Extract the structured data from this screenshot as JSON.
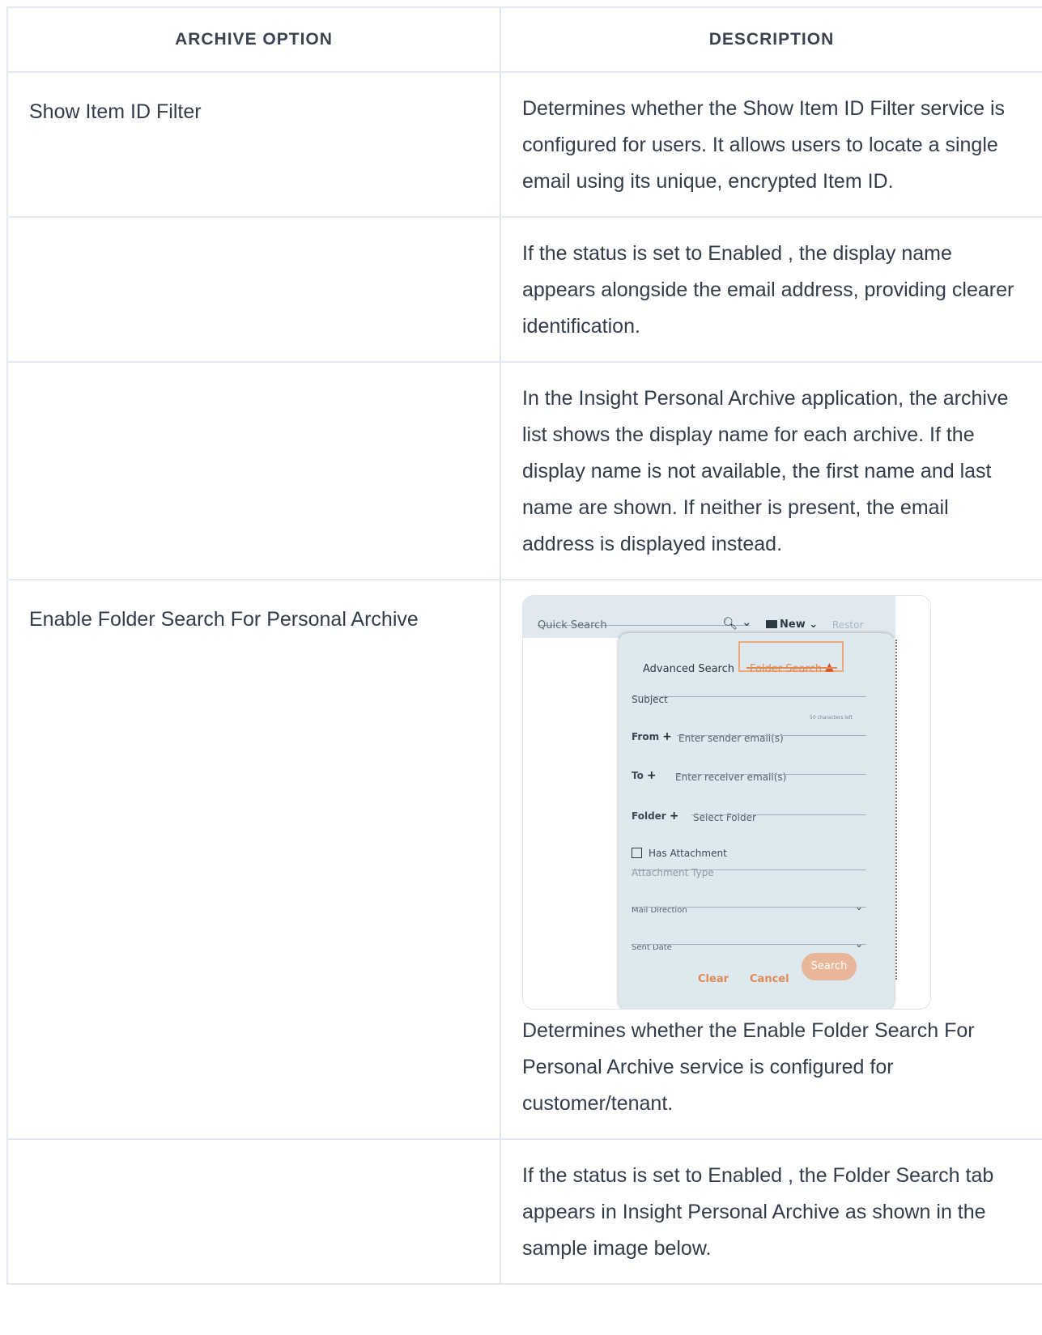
{
  "table": {
    "headers": [
      "ARCHIVE OPTION",
      "DESCRIPTION"
    ],
    "rows": [
      {
        "option": "Show Item ID Filter",
        "description": "Determines whether the Show Item ID Filter service is configured for users. It allows users to locate a single email using its unique, encrypted Item ID."
      },
      {
        "option": "",
        "description": "If the status is set to Enabled , the display name appears alongside the email address, providing clearer identification."
      },
      {
        "option": "",
        "description": "In the Insight Personal Archive application, the archive list shows the display name for each archive. If the display name is not available, the first name and last name are shown. If neither is present, the email address is displayed instead."
      },
      {
        "option": "Enable Folder Search For Personal Archive",
        "description": "Determines whether the Enable Folder Search For Personal Archive service is configured for customer/tenant."
      },
      {
        "option": "",
        "description": "If the status is set to Enabled , the Folder Search tab appears in Insight Personal Archive as shown in the sample image below."
      }
    ]
  },
  "screenshot": {
    "quick_search": "Quick Search",
    "new_label": "New",
    "restore_label": "Restor",
    "tab_advanced": "Advanced Search",
    "tab_folder": "Folder Search",
    "subject_label": "Subject",
    "chars_left": "50 characters left",
    "from_label": "From",
    "from_placeholder": "Enter sender email(s)",
    "to_label": "To",
    "to_placeholder": "Enter receiver email(s)",
    "folder_label": "Folder",
    "folder_placeholder": "Select Folder",
    "has_attachment": "Has Attachment",
    "attachment_type": "Attachment Type",
    "mail_direction": "Mail Direction",
    "sent_date": "Sent Date",
    "clear_label": "Clear",
    "cancel_label": "Cancel",
    "search_label": "Search",
    "accent_color": "#e08a55"
  }
}
